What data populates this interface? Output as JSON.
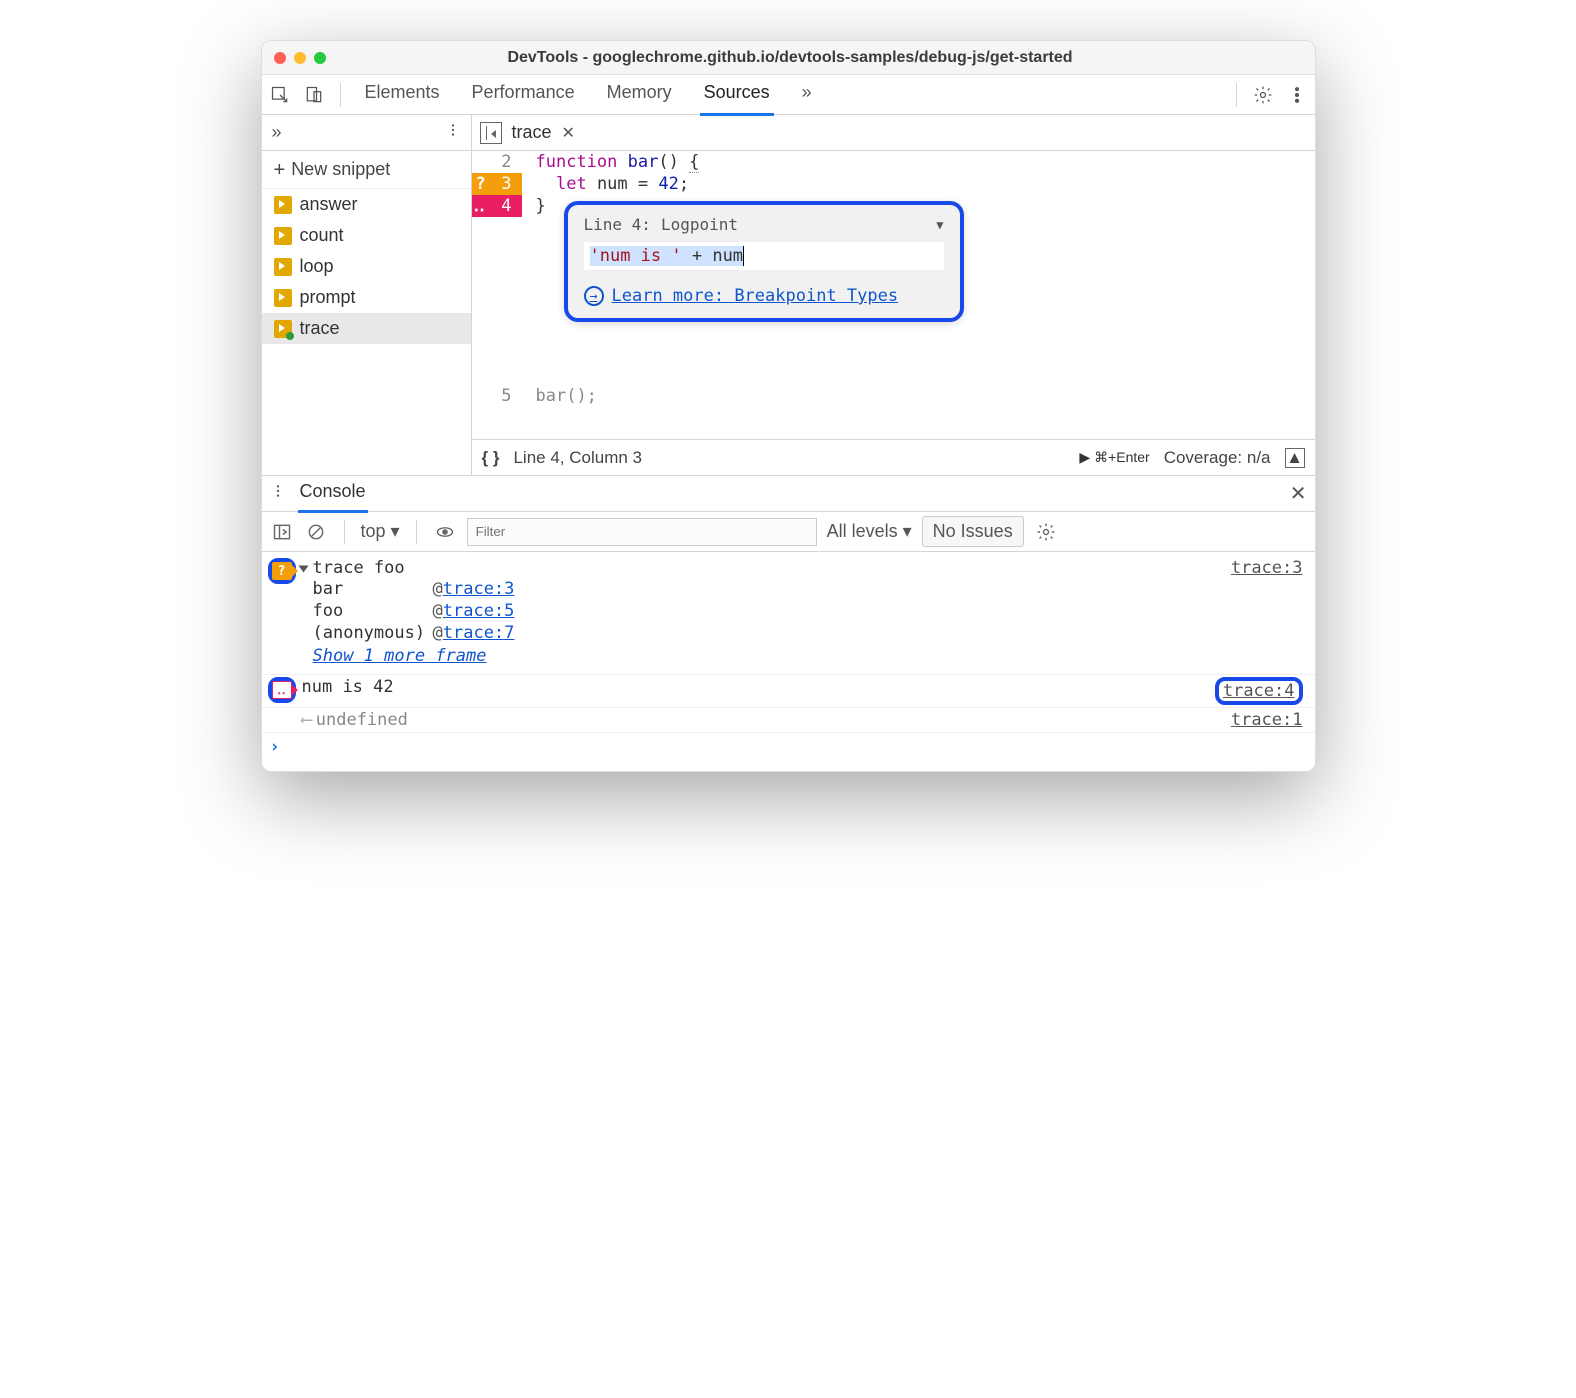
{
  "window": {
    "title": "DevTools - googlechrome.github.io/devtools-samples/debug-js/get-started"
  },
  "toolbar": {
    "tabs": [
      "Elements",
      "Performance",
      "Memory",
      "Sources"
    ],
    "active_tab": "Sources",
    "overflow": "»"
  },
  "sidebar": {
    "overflow": "»",
    "new_snippet": "New snippet",
    "items": [
      {
        "label": "answer"
      },
      {
        "label": "count"
      },
      {
        "label": "loop"
      },
      {
        "label": "prompt"
      },
      {
        "label": "trace",
        "selected": true,
        "modified": true
      }
    ]
  },
  "editor": {
    "open_tab": "trace",
    "lines": {
      "2": {
        "text": "function bar() {"
      },
      "3": {
        "text": "  let num = 42;",
        "marker": "conditional"
      },
      "4": {
        "text": "}",
        "marker": "logpoint"
      },
      "5": {
        "text": "bar();"
      }
    },
    "footer": {
      "position": "Line 4, Column 3",
      "run_hint": "⌘+Enter",
      "coverage": "Coverage: n/a"
    }
  },
  "breakpoint_popup": {
    "line_label": "Line 4:",
    "type": "Logpoint",
    "expression": "'num is ' + num",
    "link": "Learn more: Breakpoint Types"
  },
  "console": {
    "tab": "Console",
    "context": "top",
    "filter_placeholder": "Filter",
    "levels": "All levels",
    "issues": "No Issues",
    "entries": [
      {
        "kind": "trace",
        "text": "trace foo",
        "source": "trace:3",
        "stack": [
          {
            "fn": "bar",
            "loc": "trace:3"
          },
          {
            "fn": "foo",
            "loc": "trace:5"
          },
          {
            "fn": "(anonymous)",
            "loc": "trace:7"
          }
        ],
        "show_more": "Show 1 more frame"
      },
      {
        "kind": "logpoint",
        "text": "num is 42",
        "source": "trace:4"
      },
      {
        "kind": "return",
        "text": "undefined",
        "source": "trace:1"
      }
    ]
  }
}
